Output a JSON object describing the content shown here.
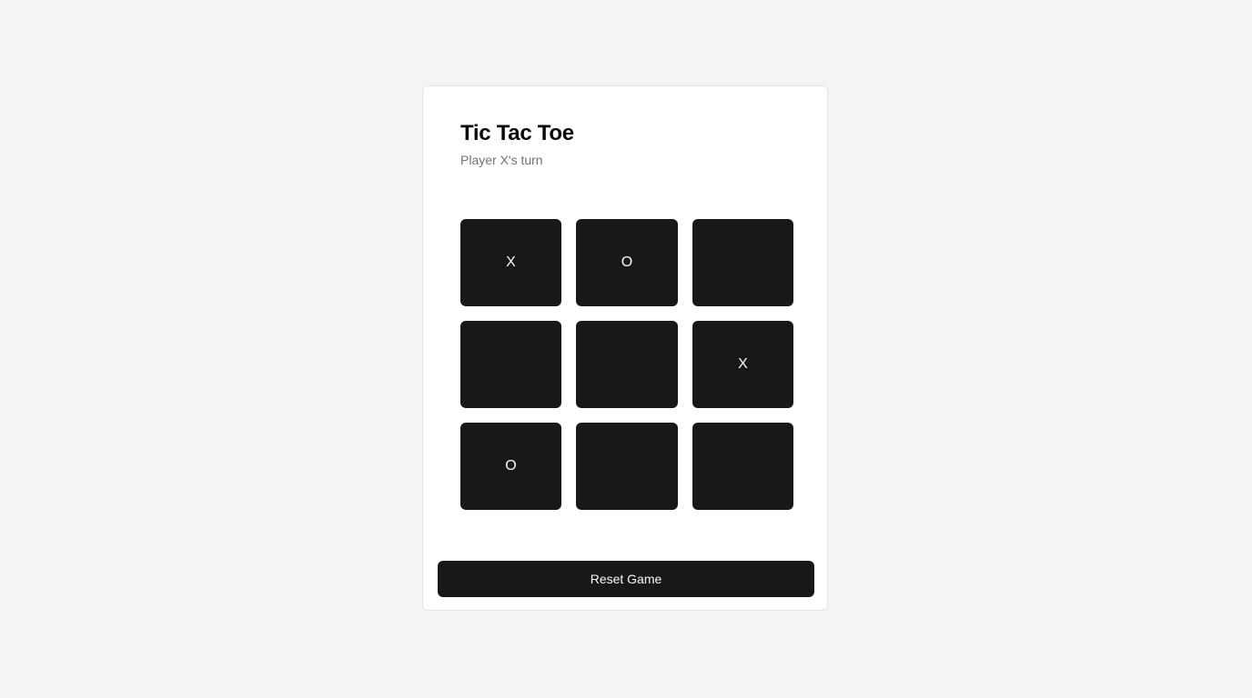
{
  "game": {
    "title": "Tic Tac Toe",
    "status": "Player X's turn",
    "board": [
      "X",
      "O",
      "",
      "",
      "",
      "X",
      "O",
      "",
      ""
    ],
    "reset_label": "Reset Game"
  }
}
